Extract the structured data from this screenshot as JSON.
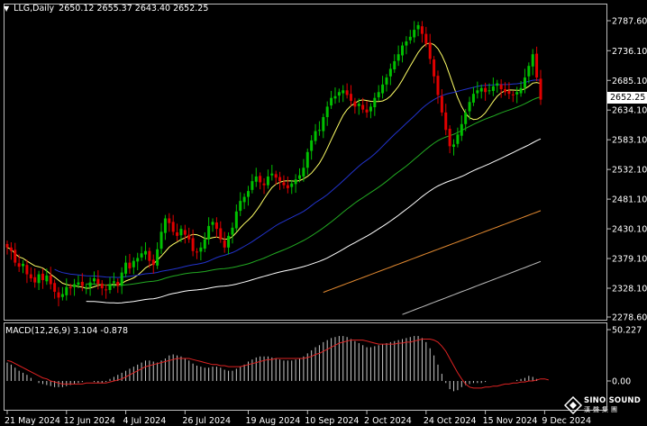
{
  "header": {
    "symbol": "LLG,Daily",
    "ohlc": "2650.12 2655.37 2643.40 2652.25"
  },
  "current_price": "2652.25",
  "macd": {
    "label": "MACD(12,26,9) 3.104 -0.878",
    "axis_ticks": [
      "50.227",
      "0.00"
    ]
  },
  "price_axis": {
    "ticks": [
      "2787.60",
      "2736.10",
      "2685.10",
      "2634.10",
      "2583.10",
      "2532.10",
      "2481.10",
      "2430.10",
      "2379.10",
      "2328.10",
      "2278.60"
    ]
  },
  "date_axis": {
    "ticks": [
      "21 May 2024",
      "12 Jun 2024",
      "4 Jul 2024",
      "26 Jul 2024",
      "19 Aug 2024",
      "10 Sep 2024",
      "2 Oct 2024",
      "24 Oct 2024",
      "15 Nov 2024",
      "9 Dec 2024"
    ]
  },
  "logo": {
    "text": "SINO SOUND",
    "cn": "漢聲集團"
  },
  "colors": {
    "bull": "#00c000",
    "bear": "#e00000",
    "ma_fast": "#ffff66",
    "ma_blue": "#2233cc",
    "ma_green": "#22aa22",
    "ma_white": "#ffffff",
    "ma_orange": "#e08830",
    "ma_gray": "#bbbbbb",
    "macd_hist": "#c8c8c8",
    "macd_signal": "#dd2222"
  },
  "chart_data": {
    "type": "candlestick",
    "ylim": [
      2270,
      2810
    ],
    "close_series": [
      2398,
      2392,
      2372,
      2365,
      2370,
      2352,
      2345,
      2338,
      2352,
      2342,
      2350,
      2335,
      2322,
      2312,
      2318,
      2330,
      2328,
      2335,
      2338,
      2332,
      2330,
      2338,
      2345,
      2335,
      2328,
      2325,
      2335,
      2340,
      2332,
      2355,
      2372,
      2362,
      2375,
      2380,
      2388,
      2392,
      2375,
      2368,
      2395,
      2425,
      2448,
      2440,
      2425,
      2418,
      2430,
      2420,
      2412,
      2392,
      2390,
      2398,
      2412,
      2435,
      2442,
      2430,
      2412,
      2398,
      2418,
      2432,
      2460,
      2478,
      2485,
      2495,
      2512,
      2520,
      2510,
      2505,
      2520,
      2525,
      2518,
      2512,
      2505,
      2500,
      2508,
      2515,
      2522,
      2535,
      2562,
      2582,
      2598,
      2600,
      2622,
      2640,
      2655,
      2658,
      2665,
      2668,
      2660,
      2650,
      2640,
      2645,
      2635,
      2630,
      2640,
      2655,
      2665,
      2678,
      2690,
      2705,
      2718,
      2730,
      2745,
      2752,
      2760,
      2772,
      2780,
      2765,
      2748,
      2722,
      2692,
      2660,
      2630,
      2600,
      2572,
      2575,
      2592,
      2610,
      2630,
      2648,
      2662,
      2668,
      2672,
      2665,
      2668,
      2675,
      2680,
      2670,
      2665,
      2662,
      2660,
      2665,
      2672,
      2690,
      2710,
      2730,
      2690,
      2652
    ],
    "macd_hist": [
      18,
      16,
      13,
      10,
      8,
      6,
      3,
      0,
      -2,
      -3,
      -4,
      -5,
      -6,
      -6,
      -6,
      -5,
      -4,
      -3,
      -2,
      -1,
      0,
      0,
      -1,
      -2,
      -2,
      -1,
      2,
      4,
      6,
      8,
      10,
      12,
      14,
      16,
      18,
      20,
      20,
      19,
      18,
      20,
      22,
      25,
      26,
      25,
      24,
      22,
      20,
      17,
      15,
      14,
      13,
      13,
      14,
      14,
      13,
      11,
      10,
      10,
      12,
      14,
      16,
      19,
      21,
      23,
      24,
      24,
      24,
      23,
      22,
      21,
      20,
      20,
      20,
      21,
      22,
      24,
      27,
      30,
      33,
      35,
      38,
      40,
      42,
      43,
      44,
      44,
      43,
      41,
      39,
      37,
      35,
      33,
      33,
      34,
      35,
      36,
      37,
      38,
      39,
      40,
      41,
      42,
      43,
      44,
      44,
      42,
      38,
      32,
      25,
      16,
      7,
      -2,
      -8,
      -10,
      -9,
      -6,
      -4,
      -3,
      -2,
      -2,
      -2,
      -1,
      0,
      0,
      0,
      0,
      0,
      0,
      0,
      1,
      2,
      3,
      5,
      4,
      2,
      0
    ],
    "macd_signal": [
      20,
      19,
      17,
      15,
      13,
      11,
      9,
      7,
      5,
      3,
      2,
      0,
      -1,
      -2,
      -3,
      -3,
      -3,
      -3,
      -3,
      -3,
      -2,
      -2,
      -2,
      -2,
      -2,
      -2,
      -1,
      0,
      1,
      2,
      4,
      6,
      8,
      10,
      12,
      14,
      15,
      16,
      17,
      18,
      19,
      20,
      21,
      22,
      22,
      22,
      22,
      21,
      20,
      19,
      18,
      17,
      16,
      16,
      15,
      15,
      14,
      14,
      14,
      14,
      15,
      16,
      17,
      18,
      19,
      20,
      21,
      21,
      22,
      22,
      22,
      22,
      22,
      22,
      22,
      22,
      23,
      24,
      26,
      27,
      29,
      31,
      33,
      35,
      37,
      38,
      39,
      40,
      40,
      40,
      40,
      39,
      38,
      37,
      36,
      36,
      36,
      36,
      36,
      37,
      37,
      38,
      38,
      39,
      40,
      41,
      41,
      41,
      40,
      38,
      34,
      29,
      22,
      15,
      8,
      2,
      -3,
      -6,
      -7,
      -7,
      -7,
      -6,
      -6,
      -5,
      -5,
      -4,
      -3,
      -3,
      -2,
      -2,
      -1,
      -1,
      0,
      0,
      1,
      2,
      2,
      1
    ]
  }
}
